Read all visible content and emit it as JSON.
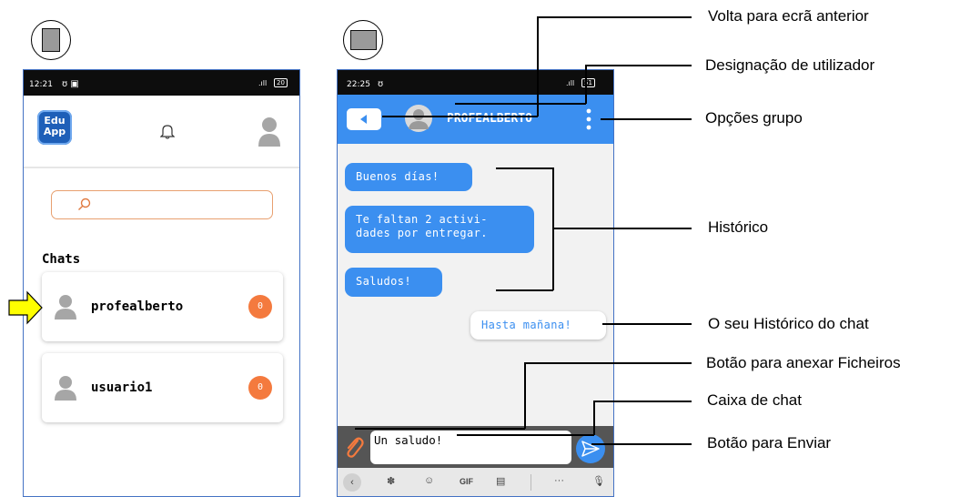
{
  "left_phone": {
    "status_time": "12:21",
    "status_battery": "20",
    "logo_text_1": "Edu",
    "logo_text_2": "App",
    "chats_heading": "Chats",
    "chats": [
      {
        "name": "profealberto",
        "badge": "0"
      },
      {
        "name": "usuario1",
        "badge": "0"
      }
    ]
  },
  "right_phone": {
    "status_time": "22:25",
    "status_battery": "51",
    "header_name": "PROFEALBERTO",
    "received_messages": [
      "Buenos días!",
      "Te faltan 2 activi-",
      "dades por entregar.",
      "Saludos!"
    ],
    "sent_message": "Hasta mañana!",
    "input_value": "Un saludo!",
    "keyboard_gif": "GIF",
    "keyboard_more": "···"
  },
  "annotations": {
    "back": "Volta para  ecrã anterior",
    "user_designation": "Designação de utilizador",
    "group_options": "Opções grupo",
    "history": "Histórico",
    "your_history": "O seu Histórico do chat",
    "attach_button": "Botão para anexar  Ficheiros",
    "chat_box": "Caixa de chat",
    "send_button": "Botão para Enviar"
  },
  "colors": {
    "primary_blue": "#3b8ff0",
    "badge_orange": "#f47a3e",
    "search_border": "#e8a070",
    "arrow_yellow": "#ffff00"
  },
  "icons": [
    "bell-icon",
    "avatar-icon",
    "search-icon",
    "back-icon",
    "more-vert-icon",
    "paperclip-icon",
    "send-icon",
    "palette-icon",
    "sticker-icon",
    "clipboard-icon",
    "mic-icon",
    "pointer-arrow-icon"
  ]
}
